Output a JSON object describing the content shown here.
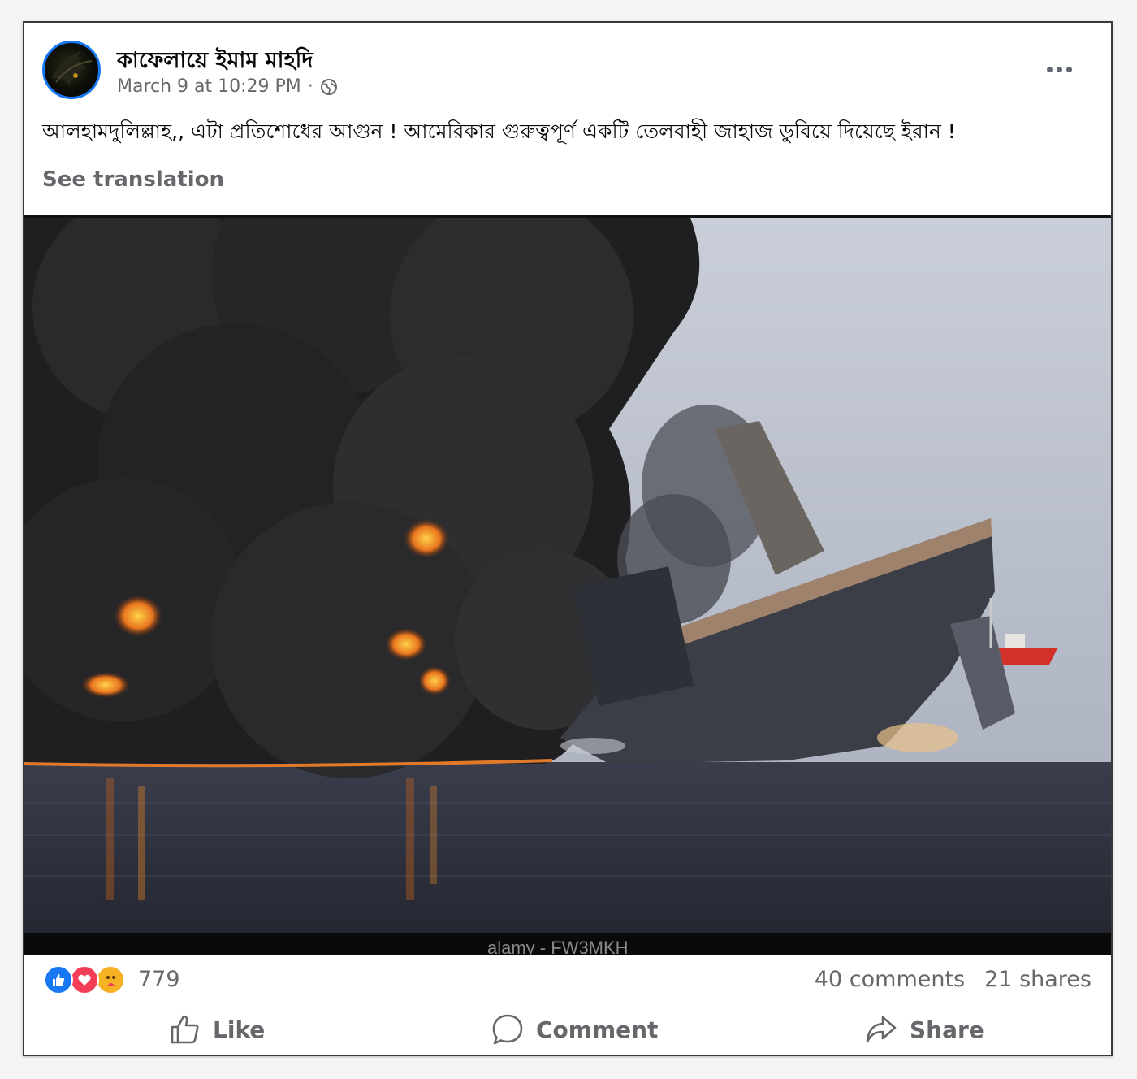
{
  "post": {
    "author": "কাফেলায়ে ইমাম মাহদি",
    "timestamp": "March 9 at 10:29 PM",
    "separator": "·",
    "privacy_icon": "globe-icon",
    "text": "আলহামদুলিল্লাহ,, এটা প্রতিশোধের আগুন ! আমেরিকার গুরুত্বপূর্ণ একটি তেলবাহী জাহাজ ডুবিয়ে দিয়েছে ইরান !",
    "see_translation": "See translation"
  },
  "photo": {
    "watermark": "alamy - FW3MKH"
  },
  "stats": {
    "reactions": [
      "like",
      "love",
      "care"
    ],
    "reaction_count": "779",
    "comments": "40 comments",
    "shares": "21 shares"
  },
  "actions": {
    "like": "Like",
    "comment": "Comment",
    "share": "Share"
  },
  "colors": {
    "brand_blue": "#1877f2",
    "love_red": "#f33e58",
    "care_yellow": "#f7b125",
    "secondary_text": "#65676b"
  }
}
